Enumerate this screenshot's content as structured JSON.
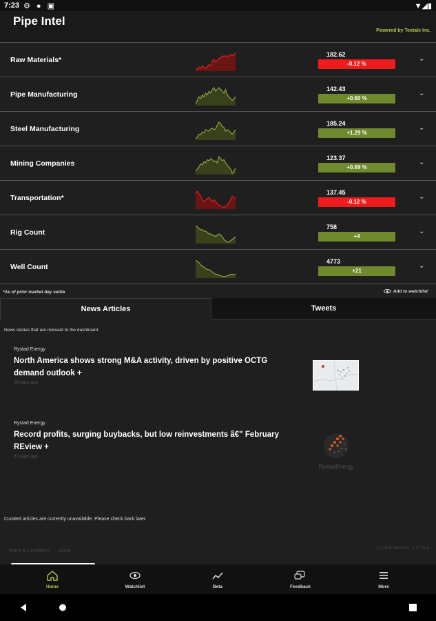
{
  "status_bar": {
    "time": "7:23"
  },
  "header": {
    "title": "Pipe Intel",
    "powered_by": "Powered by Textale Inc."
  },
  "colors": {
    "positive": "#6e8a2c",
    "negative": "#ee1c1c",
    "accent": "#b4c94a"
  },
  "rows": [
    {
      "label": "Raw Materials*",
      "value": "182.62",
      "change": "-0.12 %",
      "direction": "negative",
      "sparkline": [
        12,
        11,
        13,
        12,
        14,
        13,
        12,
        13,
        15,
        14,
        18,
        19,
        17,
        18,
        20,
        20,
        22,
        21,
        22,
        21,
        22,
        23,
        22,
        23,
        24
      ]
    },
    {
      "label": "Pipe Manufacturing",
      "value": "142.43",
      "change": "+0.60 %",
      "direction": "positive",
      "sparkline": [
        14,
        16,
        18,
        17,
        19,
        18,
        20,
        19,
        21,
        20,
        22,
        23,
        21,
        22,
        23,
        22,
        21,
        20,
        22,
        19,
        18,
        17,
        16,
        17,
        18
      ]
    },
    {
      "label": "Steel Manufacturing",
      "value": "185.24",
      "change": "+1.29 %",
      "direction": "positive",
      "sparkline": [
        6,
        8,
        12,
        11,
        15,
        14,
        18,
        17,
        16,
        19,
        20,
        18,
        19,
        24,
        28,
        26,
        22,
        21,
        16,
        18,
        17,
        14,
        12,
        15,
        18
      ]
    },
    {
      "label": "Mining Companies",
      "value": "123.37",
      "change": "+0.69 %",
      "direction": "positive",
      "sparkline": [
        10,
        12,
        14,
        17,
        16,
        19,
        18,
        21,
        20,
        22,
        21,
        19,
        20,
        18,
        24,
        22,
        20,
        21,
        18,
        16,
        14,
        12,
        8,
        10,
        13
      ]
    },
    {
      "label": "Transportation*",
      "value": "137.45",
      "change": "-0.12 %",
      "direction": "negative",
      "sparkline": [
        22,
        24,
        22,
        20,
        17,
        16,
        17,
        18,
        19,
        17,
        16,
        17,
        16,
        14,
        13,
        12,
        12,
        11,
        12,
        13,
        15,
        17,
        20,
        19,
        18
      ]
    },
    {
      "label": "Rig Count",
      "value": "758",
      "change": "+4",
      "direction": "positive",
      "sparkline": [
        22,
        21,
        20,
        19,
        19,
        18,
        18,
        17,
        16,
        16,
        15,
        15,
        14,
        15,
        16,
        15,
        14,
        12,
        11,
        10,
        10,
        11,
        12,
        13,
        14
      ]
    },
    {
      "label": "Well Count",
      "value": "4773",
      "change": "+21",
      "direction": "positive",
      "sparkline": [
        24,
        23,
        22,
        20,
        19,
        18,
        17,
        16,
        16,
        15,
        14,
        13,
        12,
        12,
        11,
        11,
        10,
        10,
        10,
        11,
        11,
        12,
        12,
        12,
        12
      ]
    }
  ],
  "footnote": "*As of prior market day settle",
  "watchlist_link": "Add to watchlist",
  "tabs": [
    "News Articles",
    "Tweets"
  ],
  "news": {
    "description": "News stories that are relevant to the dashboard",
    "articles": [
      {
        "source": "Rystad Energy",
        "headline": "North America shows strong M&A activity, driven by positive OCTG demand outlook +",
        "age": "58 days ago",
        "thumb": "map"
      },
      {
        "source": "Rystad Energy",
        "headline": "Record profits, surging buybacks, but low reinvestments â€\" February REview +",
        "age": "87 days ago",
        "thumb": "logo",
        "thumb_text": "RystadEnergy"
      }
    ]
  },
  "curated_message": "Curated articles are currently unavailable. Please check back later.",
  "footer": {
    "links": [
      "Terms & Conditions",
      "About"
    ],
    "version": "Current Version: 2.3.15.4"
  },
  "bottom_nav": [
    {
      "label": "Home",
      "icon": "home-icon",
      "active": true
    },
    {
      "label": "Watchlist",
      "icon": "eye-icon",
      "active": false
    },
    {
      "label": "Beta",
      "icon": "trend-icon",
      "active": false
    },
    {
      "label": "Feedback",
      "icon": "feedback-icon",
      "active": false
    },
    {
      "label": "More",
      "icon": "menu-icon",
      "active": false
    }
  ]
}
